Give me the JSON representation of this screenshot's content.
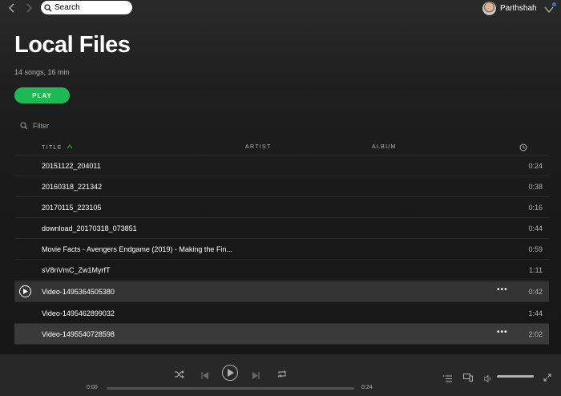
{
  "topbar": {
    "search_placeholder": "Search",
    "user_name": "Parthshah"
  },
  "header": {
    "title": "Local Files",
    "subtitle": "14 songs, 16 min",
    "play_label": "PLAY"
  },
  "filter": {
    "placeholder": "Filter"
  },
  "table": {
    "columns": {
      "title": "TITLE",
      "artist": "ARTIST",
      "album": "ALBUM"
    },
    "rows": [
      {
        "title": "20151122_204011",
        "duration": "0:24"
      },
      {
        "title": "20160318_221342",
        "duration": "0:38"
      },
      {
        "title": "20170115_223105",
        "duration": "0:16"
      },
      {
        "title": "download_20170318_073851",
        "duration": "0:44"
      },
      {
        "title": "Movie Facts - Avengers Endgame (2019) - Making the Fin...",
        "duration": "0:59"
      },
      {
        "title": "sV8nVmC_Zw1MyrfT",
        "duration": "1:11"
      },
      {
        "title": "Video-1495364505380",
        "duration": "0:42",
        "more": "•••"
      },
      {
        "title": "Video-1495462899032",
        "duration": "1:44"
      },
      {
        "title": "Video-1495540728598",
        "duration": "2:02",
        "more": "•••"
      }
    ]
  },
  "player": {
    "elapsed": "0:00",
    "total": "0:24",
    "progress_fraction": 0,
    "volume_fraction": 1.0
  },
  "colors": {
    "accent": "#1db954",
    "background": "#181818",
    "player_bar": "#282828"
  }
}
